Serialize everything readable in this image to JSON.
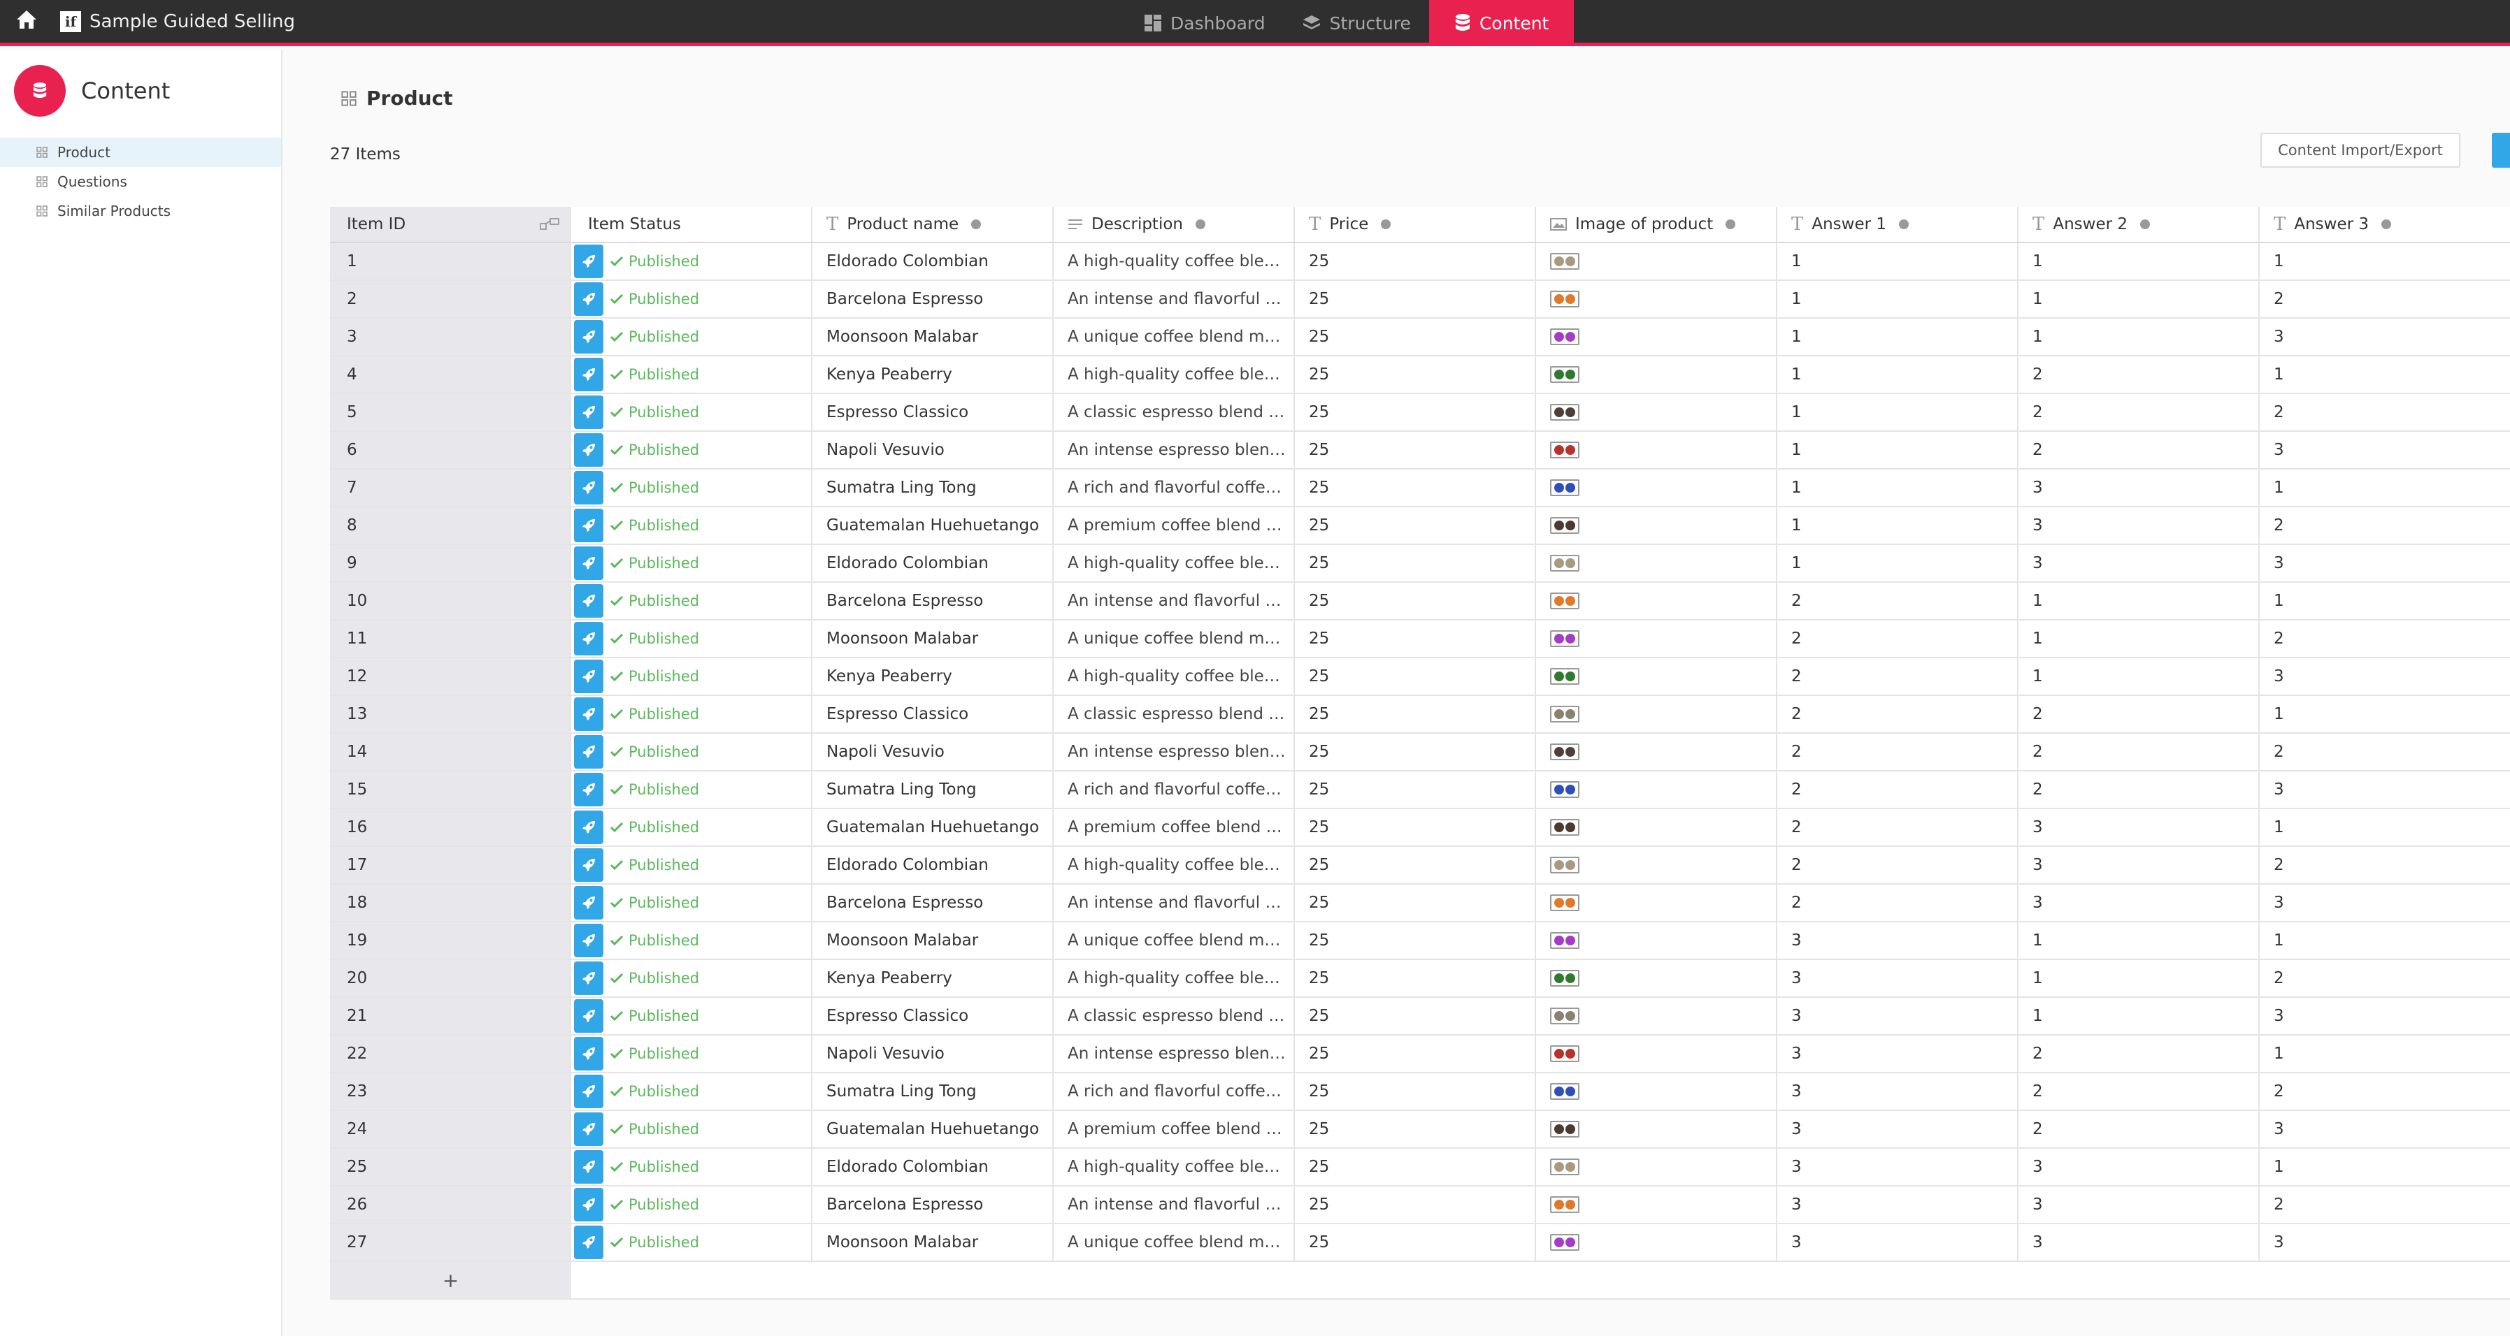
{
  "app": {
    "title": "Sample Guided Selling",
    "logo_letter": "if"
  },
  "nav": {
    "items": [
      {
        "label": "Dashboard",
        "icon": "dashboard-icon",
        "active": false
      },
      {
        "label": "Structure",
        "icon": "layers-icon",
        "active": false
      },
      {
        "label": "Content",
        "icon": "database-icon",
        "active": true
      }
    ]
  },
  "sidebar": {
    "title": "Content",
    "items": [
      {
        "label": "Product",
        "active": true
      },
      {
        "label": "Questions",
        "active": false
      },
      {
        "label": "Similar Products",
        "active": false
      }
    ]
  },
  "main": {
    "title": "Product",
    "items_count": "27 Items",
    "import_export_label": "Content Import/Export"
  },
  "table": {
    "columns": [
      {
        "label": "Item ID",
        "type": "id"
      },
      {
        "label": "Item Status",
        "type": "status"
      },
      {
        "label": "Product name",
        "type": "text"
      },
      {
        "label": "Description",
        "type": "longtext"
      },
      {
        "label": "Price",
        "type": "text"
      },
      {
        "label": "Image of product",
        "type": "image"
      },
      {
        "label": "Answer 1",
        "type": "text"
      },
      {
        "label": "Answer 2",
        "type": "text"
      },
      {
        "label": "Answer 3",
        "type": "text"
      }
    ],
    "status_label": "Published",
    "add_label": "+",
    "colors": {
      "colombian": "#a89a7e",
      "barcelona": "#e07a2a",
      "moonsoon": "#a43cc9",
      "kenya": "#2f7a2f",
      "classico": "#8a8270",
      "vesuvio": "#b8322c",
      "sumatra": "#2f4fb8",
      "guatemalan": "#4a3a30",
      "espresso_dark": "#4d4038"
    },
    "rows": [
      {
        "id": "1",
        "name": "Eldorado Colombian",
        "desc": "A high-quality coffee ble…",
        "price": "25",
        "img": "colombian",
        "a1": "1",
        "a2": "1",
        "a3": "1"
      },
      {
        "id": "2",
        "name": "Barcelona Espresso",
        "desc": "An intense and flavorful …",
        "price": "25",
        "img": "barcelona",
        "a1": "1",
        "a2": "1",
        "a3": "2"
      },
      {
        "id": "3",
        "name": "Moonsoon Malabar",
        "desc": "A unique coffee blend m…",
        "price": "25",
        "img": "moonsoon",
        "a1": "1",
        "a2": "1",
        "a3": "3"
      },
      {
        "id": "4",
        "name": "Kenya Peaberry",
        "desc": "A high-quality coffee ble…",
        "price": "25",
        "img": "kenya",
        "a1": "1",
        "a2": "2",
        "a3": "1"
      },
      {
        "id": "5",
        "name": "Espresso Classico",
        "desc": "A classic espresso blend …",
        "price": "25",
        "img": "espresso_dark",
        "a1": "1",
        "a2": "2",
        "a3": "2"
      },
      {
        "id": "6",
        "name": "Napoli Vesuvio",
        "desc": "An intense espresso blen…",
        "price": "25",
        "img": "vesuvio",
        "a1": "1",
        "a2": "2",
        "a3": "3"
      },
      {
        "id": "7",
        "name": "Sumatra Ling Tong",
        "desc": "A rich and flavorful coffe…",
        "price": "25",
        "img": "sumatra",
        "a1": "1",
        "a2": "3",
        "a3": "1"
      },
      {
        "id": "8",
        "name": "Guatemalan Huehuetango",
        "desc": "A premium coffee blend …",
        "price": "25",
        "img": "guatemalan",
        "a1": "1",
        "a2": "3",
        "a3": "2"
      },
      {
        "id": "9",
        "name": "Eldorado Colombian",
        "desc": "A high-quality coffee ble…",
        "price": "25",
        "img": "colombian",
        "a1": "1",
        "a2": "3",
        "a3": "3"
      },
      {
        "id": "10",
        "name": "Barcelona Espresso",
        "desc": "An intense and flavorful …",
        "price": "25",
        "img": "barcelona",
        "a1": "2",
        "a2": "1",
        "a3": "1"
      },
      {
        "id": "11",
        "name": "Moonsoon Malabar",
        "desc": "A unique coffee blend m…",
        "price": "25",
        "img": "moonsoon",
        "a1": "2",
        "a2": "1",
        "a3": "2"
      },
      {
        "id": "12",
        "name": "Kenya Peaberry",
        "desc": "A high-quality coffee ble…",
        "price": "25",
        "img": "kenya",
        "a1": "2",
        "a2": "1",
        "a3": "3"
      },
      {
        "id": "13",
        "name": "Espresso Classico",
        "desc": "A classic espresso blend …",
        "price": "25",
        "img": "classico",
        "a1": "2",
        "a2": "2",
        "a3": "1"
      },
      {
        "id": "14",
        "name": "Napoli Vesuvio",
        "desc": "An intense espresso blen…",
        "price": "25",
        "img": "espresso_dark",
        "a1": "2",
        "a2": "2",
        "a3": "2"
      },
      {
        "id": "15",
        "name": "Sumatra Ling Tong",
        "desc": "A rich and flavorful coffe…",
        "price": "25",
        "img": "sumatra",
        "a1": "2",
        "a2": "2",
        "a3": "3"
      },
      {
        "id": "16",
        "name": "Guatemalan Huehuetango",
        "desc": "A premium coffee blend …",
        "price": "25",
        "img": "guatemalan",
        "a1": "2",
        "a2": "3",
        "a3": "1"
      },
      {
        "id": "17",
        "name": "Eldorado Colombian",
        "desc": "A high-quality coffee ble…",
        "price": "25",
        "img": "colombian",
        "a1": "2",
        "a2": "3",
        "a3": "2"
      },
      {
        "id": "18",
        "name": "Barcelona Espresso",
        "desc": "An intense and flavorful …",
        "price": "25",
        "img": "barcelona",
        "a1": "2",
        "a2": "3",
        "a3": "3"
      },
      {
        "id": "19",
        "name": "Moonsoon Malabar",
        "desc": "A unique coffee blend m…",
        "price": "25",
        "img": "moonsoon",
        "a1": "3",
        "a2": "1",
        "a3": "1"
      },
      {
        "id": "20",
        "name": "Kenya Peaberry",
        "desc": "A high-quality coffee ble…",
        "price": "25",
        "img": "kenya",
        "a1": "3",
        "a2": "1",
        "a3": "2"
      },
      {
        "id": "21",
        "name": "Espresso Classico",
        "desc": "A classic espresso blend …",
        "price": "25",
        "img": "classico",
        "a1": "3",
        "a2": "1",
        "a3": "3"
      },
      {
        "id": "22",
        "name": "Napoli Vesuvio",
        "desc": "An intense espresso blen…",
        "price": "25",
        "img": "vesuvio",
        "a1": "3",
        "a2": "2",
        "a3": "1"
      },
      {
        "id": "23",
        "name": "Sumatra Ling Tong",
        "desc": "A rich and flavorful coffe…",
        "price": "25",
        "img": "sumatra",
        "a1": "3",
        "a2": "2",
        "a3": "2"
      },
      {
        "id": "24",
        "name": "Guatemalan Huehuetango",
        "desc": "A premium coffee blend …",
        "price": "25",
        "img": "guatemalan",
        "a1": "3",
        "a2": "2",
        "a3": "3"
      },
      {
        "id": "25",
        "name": "Eldorado Colombian",
        "desc": "A high-quality coffee ble…",
        "price": "25",
        "img": "colombian",
        "a1": "3",
        "a2": "3",
        "a3": "1"
      },
      {
        "id": "26",
        "name": "Barcelona Espresso",
        "desc": "An intense and flavorful …",
        "price": "25",
        "img": "barcelona",
        "a1": "3",
        "a2": "3",
        "a3": "2"
      },
      {
        "id": "27",
        "name": "Moonsoon Malabar",
        "desc": "A unique coffee blend m…",
        "price": "25",
        "img": "moonsoon",
        "a1": "3",
        "a2": "3",
        "a3": "3"
      }
    ]
  }
}
